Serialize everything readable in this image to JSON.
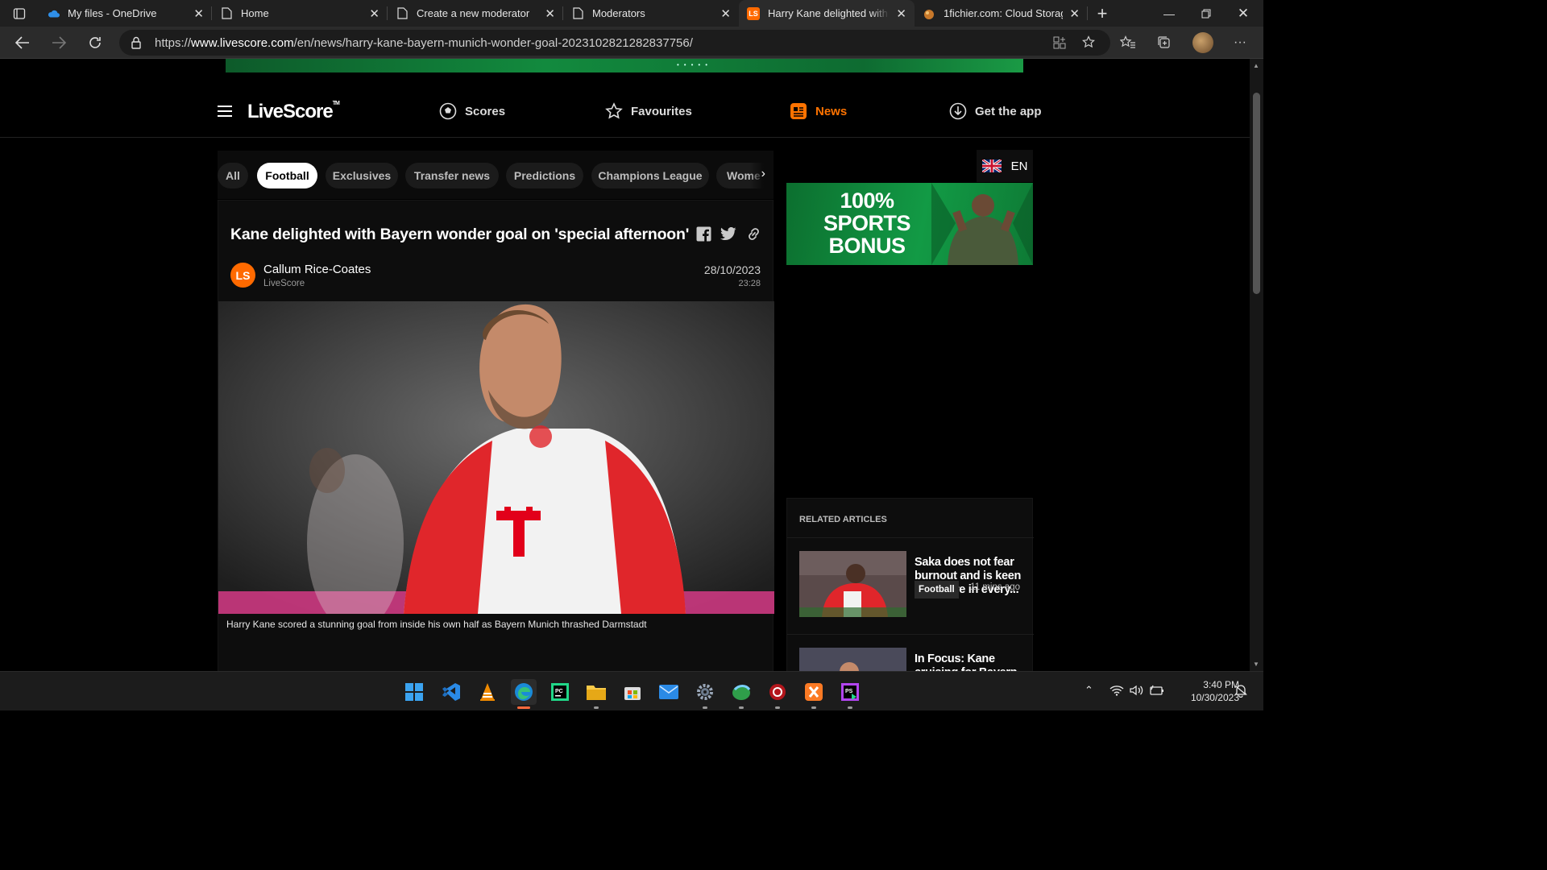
{
  "browser": {
    "tabs": [
      {
        "title": "My files - OneDrive",
        "icon": "onedrive-icon"
      },
      {
        "title": "Home",
        "icon": "page-icon"
      },
      {
        "title": "Create a new moderator",
        "icon": "page-icon"
      },
      {
        "title": "Moderators",
        "icon": "page-icon"
      },
      {
        "title": "Harry Kane delighted with B",
        "icon": "livescore-icon"
      },
      {
        "title": "1fichier.com: Cloud Storage",
        "icon": "1fichier-icon"
      }
    ],
    "url_prefix": "https://",
    "url_domain": "www.livescore.com",
    "url_path": "/en/news/harry-kane-bayern-munich-wonder-goal-20231028212828377​56/"
  },
  "site": {
    "logo": "LiveScore",
    "logo_tm": "TM",
    "nav": {
      "scores": "Scores",
      "favourites": "Favourites",
      "news": "News",
      "get_app": "Get the app"
    },
    "language": "EN"
  },
  "categories": [
    "All",
    "Football",
    "Exclusives",
    "Transfer news",
    "Predictions",
    "Champions League",
    "Wome"
  ],
  "selected_category": "Football",
  "article": {
    "title": "Kane delighted with Bayern wonder goal on 'special afternoon'",
    "author": "Callum Rice-Coates",
    "source": "LiveScore",
    "avatar_text": "LS",
    "date": "28/10/2023",
    "time": "23:28",
    "caption": "Harry Kane scored a stunning goal from inside his own half as Bayern Munich thrashed Darmstadt"
  },
  "ad": {
    "text_line1": "100%",
    "text_line2": "SPORTS",
    "text_line3": "BONUS"
  },
  "related": {
    "header": "RELATED ARTICLES",
    "items": [
      {
        "title": "Saka does not fear burnout and is keen to feature in every...",
        "tag": "Football",
        "ago": "11 mins ago"
      },
      {
        "title": "In Focus: Kane cruising for Bayern",
        "tag": "",
        "ago": ""
      }
    ]
  },
  "taskbar": {
    "time": "3:40 PM",
    "date": "10/30/2023"
  },
  "colors": {
    "accent": "#ff7300",
    "background": "#000000",
    "card": "#0d0d0d"
  }
}
